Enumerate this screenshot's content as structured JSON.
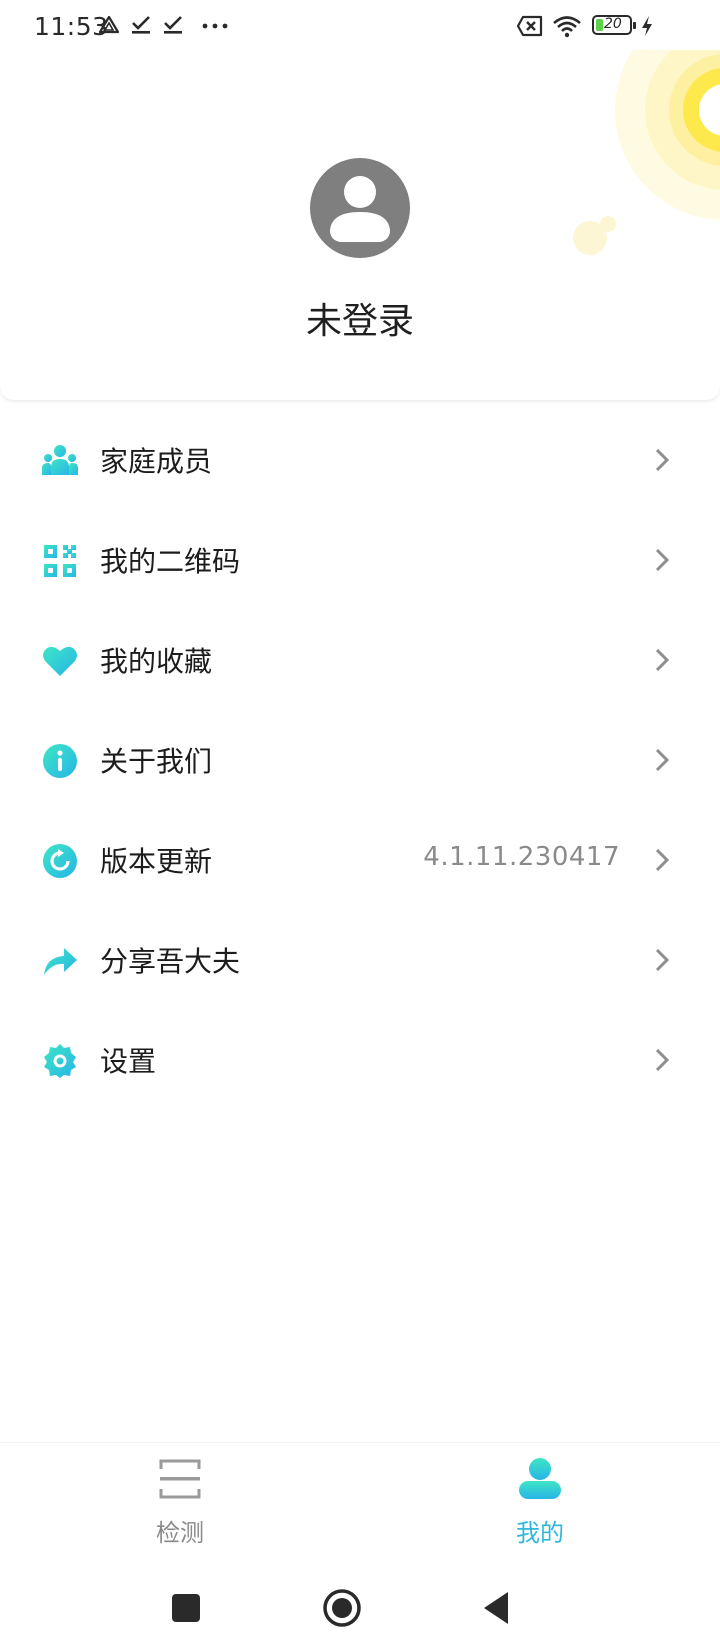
{
  "status_bar": {
    "time": "11:53",
    "battery": "20",
    "left_icons": [
      "drive-icon",
      "download-done-icon",
      "download-done-icon",
      "more-dots-icon"
    ],
    "right_icons": [
      "no-sim-icon",
      "wifi-icon",
      "battery-icon",
      "charging-icon"
    ]
  },
  "profile": {
    "name": "未登录",
    "avatar_icon": "user-avatar-icon"
  },
  "menu": {
    "items": [
      {
        "label": "家庭成员",
        "icon": "family-members-icon",
        "value": ""
      },
      {
        "label": "我的二维码",
        "icon": "qr-code-icon",
        "value": ""
      },
      {
        "label": "我的收藏",
        "icon": "heart-icon",
        "value": ""
      },
      {
        "label": "关于我们",
        "icon": "info-icon",
        "value": ""
      },
      {
        "label": "版本更新",
        "icon": "update-icon",
        "value": "4.1.11.230417"
      },
      {
        "label": "分享吾大夫",
        "icon": "share-icon",
        "value": ""
      },
      {
        "label": "设置",
        "icon": "settings-icon",
        "value": ""
      }
    ]
  },
  "bottom_nav": {
    "tabs": [
      {
        "label": "检测",
        "icon": "scan-icon",
        "active": false
      },
      {
        "label": "我的",
        "icon": "profile-icon",
        "active": true
      }
    ]
  },
  "colors": {
    "accent": "#2fb8dc",
    "icon_gradient_start": "#3ee6c4",
    "icon_gradient_end": "#27b4e8",
    "inactive": "#8a8a8a",
    "sun": "#fde94b"
  }
}
